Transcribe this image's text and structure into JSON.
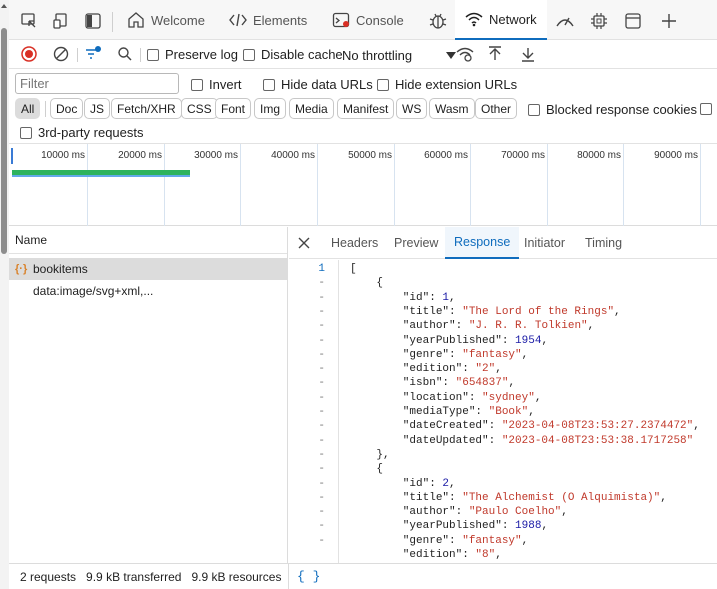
{
  "tabbar": {
    "tabs": [
      {
        "label": "Welcome",
        "icon": "home-icon"
      },
      {
        "label": "Elements",
        "icon": "code-brackets-icon"
      },
      {
        "label": "Console",
        "icon": "console-icon"
      },
      {
        "label": "Network",
        "icon": "wifi-icon"
      }
    ],
    "active": "Network"
  },
  "toolbar": {
    "preserve_log": "Preserve log",
    "disable_cache": "Disable cache",
    "throttling": "No throttling"
  },
  "filters": {
    "placeholder": "Filter",
    "invert": "Invert",
    "hide_data_urls": "Hide data URLs",
    "hide_extension_urls": "Hide extension URLs",
    "types": [
      "All",
      "Doc",
      "JS",
      "Fetch/XHR",
      "CSS",
      "Font",
      "Img",
      "Media",
      "Manifest",
      "WS",
      "Wasm",
      "Other"
    ],
    "active_type": "All",
    "blocked_cookies": "Blocked response cookies",
    "third_party": "3rd-party requests"
  },
  "overview": {
    "ticks": [
      "10000 ms",
      "20000 ms",
      "30000 ms",
      "40000 ms",
      "50000 ms",
      "60000 ms",
      "70000 ms",
      "80000 ms",
      "90000 ms"
    ]
  },
  "requests": {
    "header": "Name",
    "items": [
      {
        "name": "bookitems",
        "icon": "fetch-braces-icon",
        "selected": true
      },
      {
        "name": "data:image/svg+xml,...",
        "icon": "",
        "selected": false
      }
    ]
  },
  "detail": {
    "tabs": [
      "Headers",
      "Preview",
      "Response",
      "Initiator",
      "Timing"
    ],
    "active": "Response",
    "line_numbers": [
      "1",
      "-",
      "-",
      "-",
      "-",
      "-",
      "-",
      "-",
      "-",
      "-",
      "-",
      "-",
      "-",
      "-",
      "-",
      "-",
      "-",
      "-",
      "-",
      "-"
    ],
    "format_button": "{ }"
  },
  "response_lines": [
    {
      "t": "["
    },
    {
      "t": "    {"
    },
    {
      "k": "        \"id\": ",
      "n": "1",
      "e": ","
    },
    {
      "k": "        \"title\": ",
      "s": "\"The Lord of the Rings\"",
      "e": ","
    },
    {
      "k": "        \"author\": ",
      "s": "\"J. R. R. Tolkien\"",
      "e": ","
    },
    {
      "k": "        \"yearPublished\": ",
      "n": "1954",
      "e": ","
    },
    {
      "k": "        \"genre\": ",
      "s": "\"fantasy\"",
      "e": ","
    },
    {
      "k": "        \"edition\": ",
      "s": "\"2\"",
      "e": ","
    },
    {
      "k": "        \"isbn\": ",
      "s": "\"654837\"",
      "e": ","
    },
    {
      "k": "        \"location\": ",
      "s": "\"sydney\"",
      "e": ","
    },
    {
      "k": "        \"mediaType\": ",
      "s": "\"Book\"",
      "e": ","
    },
    {
      "k": "        \"dateCreated\": ",
      "s": "\"2023-04-08T23:53:27.2374472\"",
      "e": ","
    },
    {
      "k": "        \"dateUpdated\": ",
      "s": "\"2023-04-08T23:53:38.1717258\"",
      "e": ""
    },
    {
      "t": "    },"
    },
    {
      "t": "    {"
    },
    {
      "k": "        \"id\": ",
      "n": "2",
      "e": ","
    },
    {
      "k": "        \"title\": ",
      "s": "\"The Alchemist (O Alquimista)\"",
      "e": ","
    },
    {
      "k": "        \"author\": ",
      "s": "\"Paulo Coelho\"",
      "e": ","
    },
    {
      "k": "        \"yearPublished\": ",
      "n": "1988",
      "e": ","
    },
    {
      "k": "        \"genre\": ",
      "s": "\"fantasy\"",
      "e": ","
    },
    {
      "k": "        \"edition\": ",
      "s": "\"8\"",
      "e": ","
    }
  ],
  "status": {
    "requests": "2 requests",
    "transferred": "9.9 kB transferred",
    "resources": "9.9 kB resources"
  },
  "colors": {
    "accent": "#0f6cbd",
    "string": "#c0392b",
    "number": "#1a1aa6",
    "record_stop": "#d93025"
  }
}
